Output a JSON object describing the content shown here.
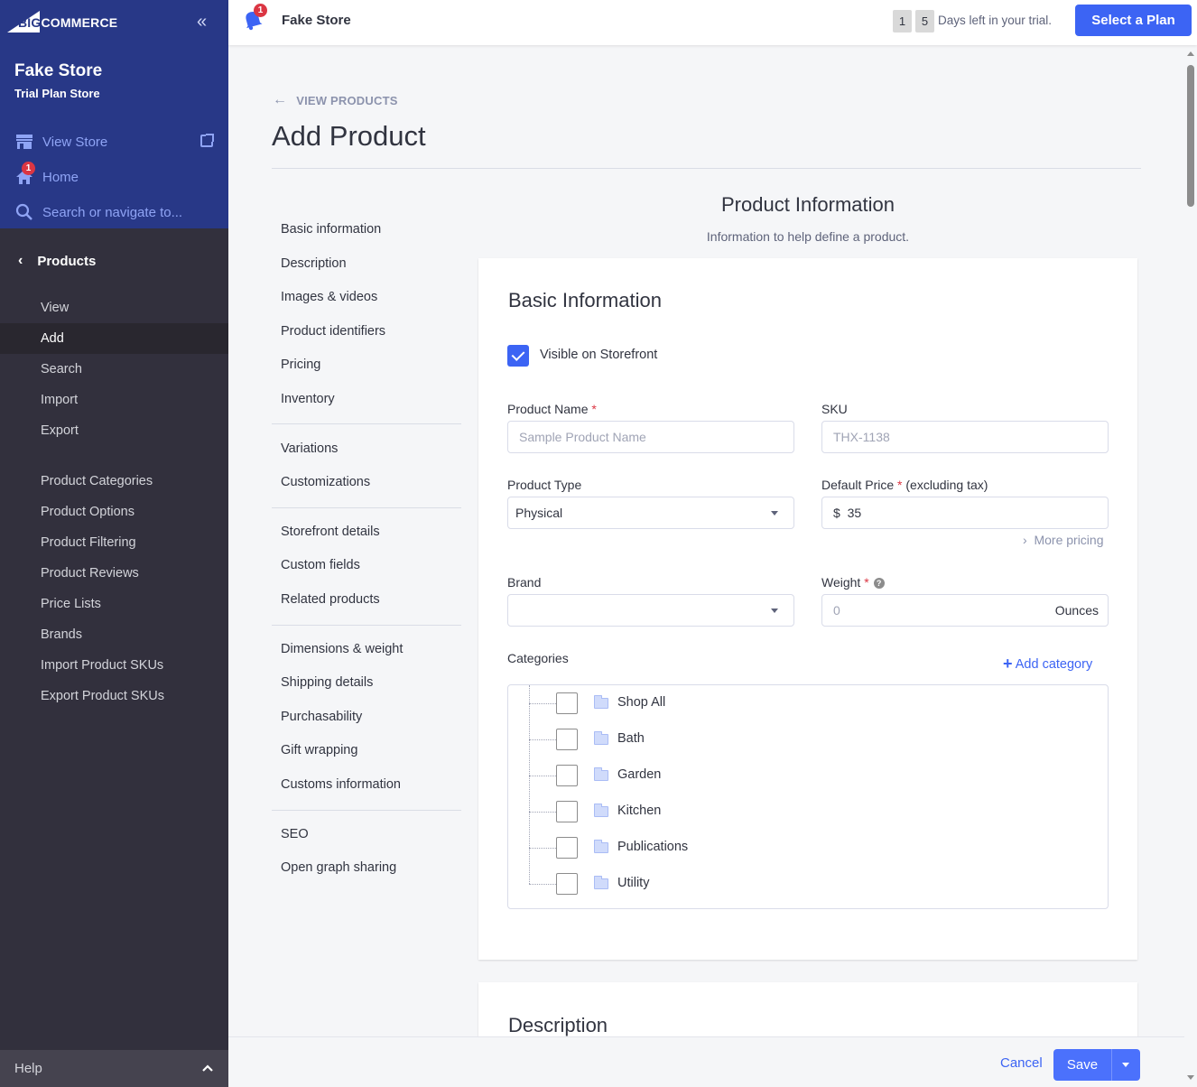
{
  "brand": {
    "logo_big": "BIG",
    "logo_rest": "COMMERCE"
  },
  "sidebar": {
    "store_name": "Fake Store",
    "store_plan": "Trial Plan Store",
    "view_store": "View Store",
    "home": "Home",
    "home_badge": "1",
    "search_placeholder": "Search or navigate to...",
    "section": "Products",
    "items": [
      {
        "label": "View",
        "active": false
      },
      {
        "label": "Add",
        "active": true
      },
      {
        "label": "Search",
        "active": false
      },
      {
        "label": "Import",
        "active": false
      },
      {
        "label": "Export",
        "active": false
      }
    ],
    "items2": [
      {
        "label": "Product Categories"
      },
      {
        "label": "Product Options"
      },
      {
        "label": "Product Filtering"
      },
      {
        "label": "Product Reviews"
      },
      {
        "label": "Price Lists"
      },
      {
        "label": "Brands"
      },
      {
        "label": "Import Product SKUs"
      },
      {
        "label": "Export Product SKUs"
      }
    ],
    "help": "Help"
  },
  "header": {
    "notif_badge": "1",
    "store_name": "Fake Store",
    "trial_digits": [
      "1",
      "5"
    ],
    "trial_text": "Days left in your trial.",
    "plan_button": "Select a Plan"
  },
  "page": {
    "back_link": "VIEW PRODUCTS",
    "title": "Add Product"
  },
  "toc": {
    "groups": [
      [
        "Basic information",
        "Description",
        "Images & videos",
        "Product identifiers",
        "Pricing",
        "Inventory"
      ],
      [
        "Variations",
        "Customizations"
      ],
      [
        "Storefront details",
        "Custom fields",
        "Related products"
      ],
      [
        "Dimensions & weight",
        "Shipping details",
        "Purchasability",
        "Gift wrapping",
        "Customs information"
      ],
      [
        "SEO",
        "Open graph sharing"
      ]
    ]
  },
  "section": {
    "title": "Product Information",
    "subtitle": "Information to help define a product."
  },
  "basic": {
    "title": "Basic Information",
    "visible_label": "Visible on Storefront",
    "visible_checked": true,
    "product_name_label": "Product Name",
    "product_name_placeholder": "Sample Product Name",
    "sku_label": "SKU",
    "sku_placeholder": "THX-1138",
    "product_type_label": "Product Type",
    "product_type_value": "Physical",
    "price_label": "Default Price",
    "price_suffix": "(excluding tax)",
    "currency": "$",
    "price_value": "35",
    "more_pricing": "More pricing",
    "brand_label": "Brand",
    "brand_value": "",
    "weight_label": "Weight",
    "weight_placeholder": "0",
    "weight_unit": "Ounces",
    "categories_label": "Categories",
    "add_category": "Add category",
    "categories": [
      {
        "name": "Shop All",
        "checked": false
      },
      {
        "name": "Bath",
        "checked": false
      },
      {
        "name": "Garden",
        "checked": false
      },
      {
        "name": "Kitchen",
        "checked": false
      },
      {
        "name": "Publications",
        "checked": false
      },
      {
        "name": "Utility",
        "checked": false
      }
    ]
  },
  "description": {
    "title": "Description"
  },
  "footer": {
    "cancel": "Cancel",
    "save": "Save"
  },
  "colors": {
    "accent": "#3c64f4",
    "sidebar_top": "#283887",
    "sidebar": "#32303d",
    "required": "#db3643"
  }
}
